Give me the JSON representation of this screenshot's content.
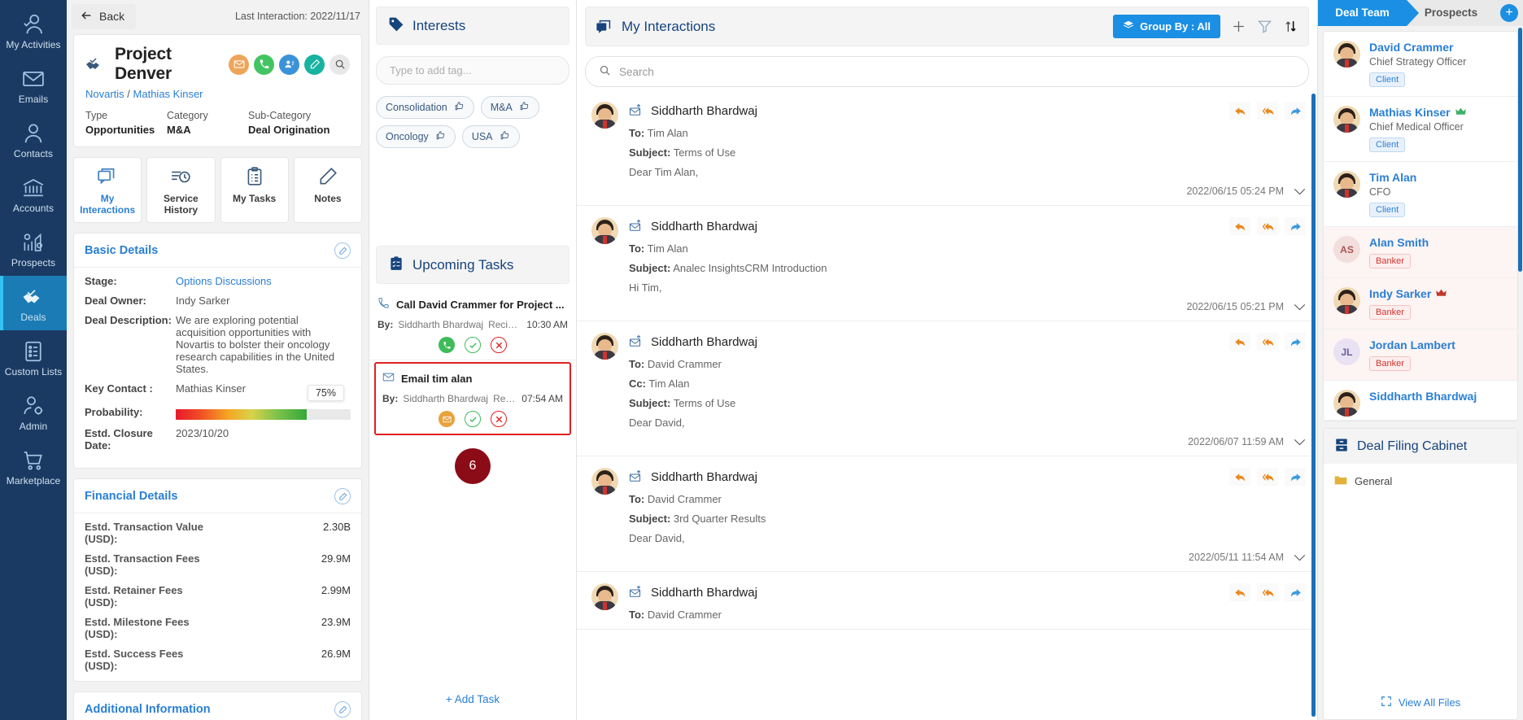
{
  "nav": {
    "items": [
      {
        "label": "My Activities",
        "icon": "user-check-icon",
        "active": false
      },
      {
        "label": "Emails",
        "icon": "envelope-icon",
        "active": false
      },
      {
        "label": "Contacts",
        "icon": "person-icon",
        "active": false
      },
      {
        "label": "Accounts",
        "icon": "bank-icon",
        "active": false
      },
      {
        "label": "Prospects",
        "icon": "chart-gear-icon",
        "active": false
      },
      {
        "label": "Deals",
        "icon": "handshake-check-icon",
        "active": true
      },
      {
        "label": "Custom Lists",
        "icon": "list-icon",
        "active": false
      },
      {
        "label": "Admin",
        "icon": "person-gear-icon",
        "active": false
      },
      {
        "label": "Marketplace",
        "icon": "cart-icon",
        "active": false
      }
    ]
  },
  "topbar": {
    "back_label": "Back",
    "last_interaction": "Last Interaction: 2022/11/17"
  },
  "deal": {
    "title": "Project Denver",
    "account": "Novartis",
    "separator": " / ",
    "contact": "Mathias Kinser",
    "action_icons": [
      "email-icon",
      "call-icon",
      "meeting-icon",
      "note-icon",
      "search-icon"
    ],
    "meta": [
      {
        "key": "Type",
        "value": "Opportunities"
      },
      {
        "key": "Category",
        "value": "M&A"
      },
      {
        "key": "Sub-Category",
        "value": "Deal Origination"
      }
    ]
  },
  "tabs": [
    {
      "label": "My Interactions",
      "icon": "interactions-icon",
      "active": true
    },
    {
      "label": "Service History",
      "icon": "history-icon",
      "active": false
    },
    {
      "label": "My Tasks",
      "icon": "tasks-icon",
      "active": false
    },
    {
      "label": "Notes",
      "icon": "notes-icon",
      "active": false
    }
  ],
  "basic_details": {
    "title": "Basic Details",
    "rows": [
      {
        "key": "Stage:",
        "value": "Options Discussions",
        "link": true
      },
      {
        "key": "Deal Owner:",
        "value": "Indy Sarker",
        "link": false
      },
      {
        "key": "Deal Description:",
        "value": "We are exploring potential acquisition opportunities with Novartis to bolster their oncology research capabilities in the United States.",
        "link": false
      },
      {
        "key": "Key Contact :",
        "value": "Mathias Kinser",
        "link": false
      }
    ],
    "probability": {
      "key": "Probability:",
      "value": "75%",
      "percent": 75
    },
    "closure": {
      "key": "Estd. Closure Date:",
      "value": "2023/10/20"
    }
  },
  "financial_details": {
    "title": "Financial Details",
    "rows": [
      {
        "key": "Estd. Transaction Value (USD):",
        "value": "2.30B"
      },
      {
        "key": "Estd. Transaction Fees (USD):",
        "value": "29.9M"
      },
      {
        "key": "Estd. Retainer Fees (USD):",
        "value": "2.99M"
      },
      {
        "key": "Estd. Milestone Fees (USD):",
        "value": "23.9M"
      },
      {
        "key": "Estd. Success Fees (USD):",
        "value": "26.9M"
      }
    ]
  },
  "additional_information": {
    "title": "Additional Information"
  },
  "interests": {
    "title": "Interests",
    "input_placeholder": "Type to add tag...",
    "tags": [
      "Consolidation",
      "M&A",
      "Oncology",
      "USA"
    ]
  },
  "upcoming_tasks": {
    "title": "Upcoming Tasks",
    "add_label": "+ Add Task",
    "badge": "6",
    "items": [
      {
        "title": "Call David Crammer for Project ...",
        "icon": "phone-icon",
        "by_label": "By:",
        "by": "Siddharth Bhardwaj",
        "recipient": "Recipien...",
        "time": "10:30 AM",
        "selected": false,
        "action_icon": "call-icon"
      },
      {
        "title": "Email tim alan",
        "icon": "envelope-icon",
        "by_label": "By:",
        "by": "Siddharth Bhardwaj",
        "recipient": "Recipien...",
        "time": "07:54 AM",
        "selected": true,
        "action_icon": "email-icon"
      }
    ]
  },
  "interactions": {
    "title": "My Interactions",
    "group_by_label": "Group By : All",
    "tools": [
      "add-icon",
      "filter-icon",
      "sort-icon"
    ],
    "search_placeholder": "Search",
    "items": [
      {
        "name": "Siddharth Bhardwaj",
        "to_label": "To:",
        "to": "Tim Alan",
        "cc_label": "",
        "cc": "",
        "subject_label": "Subject:",
        "subject": "Terms of Use",
        "preview": "Dear Tim Alan,",
        "date": "2022/06/15 05:24 PM",
        "avatar_type": "photo",
        "initials": ""
      },
      {
        "name": "Siddharth Bhardwaj",
        "to_label": "To:",
        "to": "Tim Alan",
        "cc_label": "",
        "cc": "",
        "subject_label": "Subject:",
        "subject": "Analec InsightsCRM Introduction",
        "preview": "Hi Tim,",
        "date": "2022/06/15 05:21 PM",
        "avatar_type": "photo",
        "initials": ""
      },
      {
        "name": "Siddharth Bhardwaj",
        "to_label": "To:",
        "to": "David Crammer",
        "cc_label": "Cc:",
        "cc": "Tim Alan",
        "subject_label": "Subject:",
        "subject": "Terms of Use",
        "preview": "Dear David,",
        "date": "2022/06/07 11:59 AM",
        "avatar_type": "photo",
        "initials": ""
      },
      {
        "name": "Siddharth Bhardwaj",
        "to_label": "To:",
        "to": "David Crammer",
        "cc_label": "",
        "cc": "",
        "subject_label": "Subject:",
        "subject": "3rd Quarter Results",
        "preview": "Dear David,",
        "date": "2022/05/11 11:54 AM",
        "avatar_type": "photo",
        "initials": ""
      },
      {
        "name": "Siddharth Bhardwaj",
        "to_label": "To:",
        "to": "David Crammer",
        "cc_label": "",
        "cc": "",
        "subject_label": "",
        "subject": "",
        "preview": "",
        "date": "",
        "avatar_type": "photo",
        "initials": ""
      }
    ]
  },
  "deal_team": {
    "tabs": [
      {
        "label": "Deal Team",
        "active": true
      },
      {
        "label": "Prospects",
        "active": false
      }
    ],
    "add_icon": "plus-icon",
    "members": [
      {
        "name": "David Crammer",
        "role": "Chief Strategy Officer",
        "badge": "Client",
        "badge_type": "client",
        "avatar_type": "photo",
        "initials": "",
        "crown": false,
        "highlight": false
      },
      {
        "name": "Mathias Kinser",
        "role": "Chief Medical Officer",
        "badge": "Client",
        "badge_type": "client",
        "avatar_type": "photo",
        "initials": "",
        "crown": true,
        "highlight": false
      },
      {
        "name": "Tim Alan",
        "role": "CFO",
        "badge": "Client",
        "badge_type": "client",
        "avatar_type": "photo",
        "initials": "",
        "crown": false,
        "highlight": false
      },
      {
        "name": "Alan Smith",
        "role": "",
        "badge": "Banker",
        "badge_type": "banker",
        "avatar_type": "initials",
        "initials": "AS",
        "crown": false,
        "highlight": true
      },
      {
        "name": "Indy Sarker",
        "role": "",
        "badge": "Banker",
        "badge_type": "banker",
        "avatar_type": "photo",
        "initials": "",
        "crown": true,
        "highlight": true
      },
      {
        "name": "Jordan Lambert",
        "role": "",
        "badge": "Banker",
        "badge_type": "banker",
        "avatar_type": "initials",
        "initials": "JL",
        "crown": false,
        "highlight": true
      },
      {
        "name": "Siddharth Bhardwaj",
        "role": "",
        "badge": "",
        "badge_type": "",
        "avatar_type": "photo",
        "initials": "",
        "crown": false,
        "highlight": false
      }
    ]
  },
  "filing_cabinet": {
    "title": "Deal Filing Cabinet",
    "folder": "General",
    "view_all": "View All Files"
  },
  "colors": {
    "nav_bg": "#1b3a63",
    "accent_blue": "#1a8fe3",
    "link_blue": "#2a7fd4",
    "header_navy": "#16447c",
    "alert_red": "#e02020",
    "badge_maroon": "#8b0b17"
  }
}
